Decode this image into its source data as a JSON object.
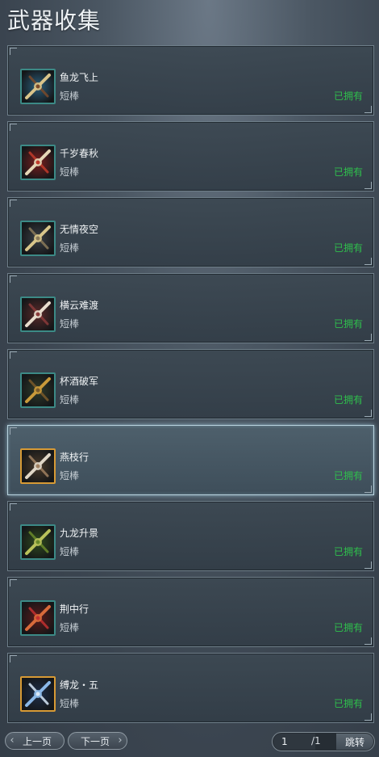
{
  "page_title": "武器收集",
  "weapons": [
    {
      "name": "鱼龙飞上",
      "type": "短棒",
      "status": "已拥有",
      "icon": "weapon-icon",
      "palette": [
        "#2a5d7a",
        "#d9c48a",
        "#7a4a2a"
      ]
    },
    {
      "name": "千岁春秋",
      "type": "短棒",
      "status": "已拥有",
      "icon": "weapon-icon",
      "palette": [
        "#7a1f1f",
        "#e6d7b6",
        "#c23b2b"
      ]
    },
    {
      "name": "无情夜空",
      "type": "短棒",
      "status": "已拥有",
      "icon": "weapon-icon",
      "palette": [
        "#3a3f45",
        "#d8c58a",
        "#8a7a5a"
      ]
    },
    {
      "name": "横云难渡",
      "type": "短棒",
      "status": "已拥有",
      "icon": "weapon-icon",
      "palette": [
        "#5a2a2a",
        "#e8dccd",
        "#8a3a3a"
      ]
    },
    {
      "name": "杯酒破军",
      "type": "短棒",
      "status": "已拥有",
      "icon": "weapon-icon",
      "palette": [
        "#2f3b2a",
        "#c89a3a",
        "#7a5a2a"
      ]
    },
    {
      "name": "燕枝行",
      "type": "短棒",
      "status": "已拥有",
      "icon": "weapon-icon",
      "palette": [
        "#4a3a2a",
        "#e0d6c6",
        "#a08060"
      ]
    },
    {
      "name": "九龙升景",
      "type": "短棒",
      "status": "已拥有",
      "icon": "weapon-icon",
      "palette": [
        "#2f4a1f",
        "#b8c25a",
        "#6a8a2a"
      ]
    },
    {
      "name": "荆中行",
      "type": "短棒",
      "status": "已拥有",
      "icon": "weapon-icon",
      "palette": [
        "#5a1a1a",
        "#d86a3a",
        "#c23030"
      ]
    },
    {
      "name": "缚龙・五",
      "type": "短棒",
      "status": "已拥有",
      "icon": "weapon-icon",
      "palette": [
        "#1f2f4a",
        "#8ab8e8",
        "#d8e8f8"
      ]
    }
  ],
  "selected_index": 5,
  "pagination": {
    "prev_label": "上一页",
    "next_label": "下一页",
    "current_page": "1",
    "total_pages": "/1",
    "jump_label": "跳转"
  },
  "colors": {
    "owned_status": "#2fbf4c",
    "selected_border": "#b9d3de",
    "icon_border": "#3c8a86",
    "icon_border_selected": "#d79a35"
  }
}
